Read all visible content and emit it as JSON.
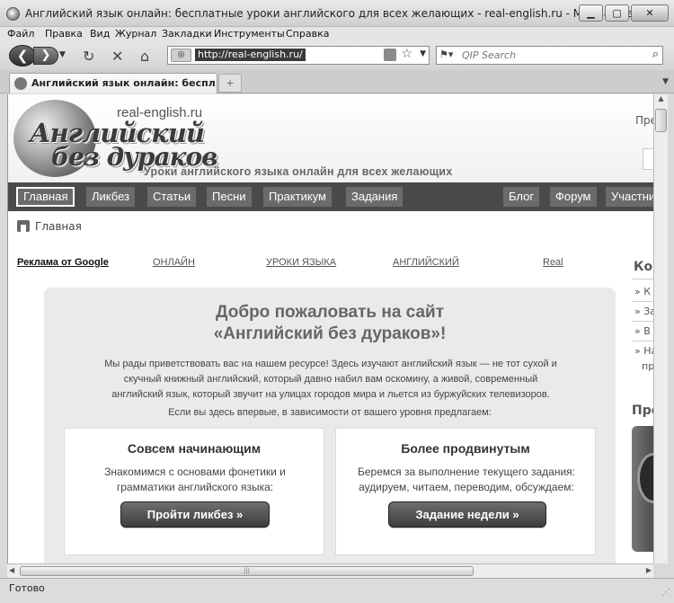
{
  "window": {
    "title": "Английский язык онлайн: бесплатные уроки английского для всех желающих - real-english.ru - Mozilla Firefox",
    "buttons": {
      "minimize": "▁",
      "maximize": "▢",
      "close": "✕"
    }
  },
  "menubar": {
    "items": [
      "Файл",
      "Правка",
      "Вид",
      "Журнал",
      "Закладки",
      "Инструменты",
      "Справка"
    ]
  },
  "toolbar": {
    "url": "http://real-english.ru/",
    "search_placeholder": "QIP Search"
  },
  "tabs": [
    {
      "label": "Английский язык онлайн: бесплат..."
    }
  ],
  "site": {
    "domain": "real-english.ru",
    "logo_line1": "Английский",
    "logo_line2": "без дураков",
    "slogan": "Уроки английского языка онлайн для всех желающих",
    "header_right_text": "Пре"
  },
  "nav": {
    "items": [
      "Главная",
      "Ликбез",
      "Статьи",
      "Песни",
      "Практикум",
      "Задания",
      "Блог",
      "Форум",
      "Участники"
    ],
    "active": "Главная"
  },
  "breadcrumb": {
    "text": "Главная"
  },
  "ads": {
    "label": "Реклама от Google",
    "links": [
      "ОНЛАЙН",
      "УРОКИ ЯЗЫКА",
      "АНГЛИЙСКИЙ",
      "Real"
    ]
  },
  "welcome": {
    "title_line1": "Добро пожаловать на сайт",
    "title_line2": "«Английский без дураков»!",
    "text_line1": "Мы рады приветствовать вас на нашем ресурсе! Здесь изучают английский язык — не тот сухой и",
    "text_line2": "скучный книжный английский, который давно набил вам оскомину, а живой, современный",
    "text_line3": "английский язык, который звучит на улицах городов мира и льется из буржуйских телевизоров.",
    "subtitle": "Если вы здесь впервые, в зависимости от вашего уровня предлагаем:",
    "cards": [
      {
        "title": "Совсем начинающим",
        "text_line1": "Знакомимся с основами фонетики и",
        "text_line2": "грамматики английского языка:",
        "button": "Пройти ликбез »"
      },
      {
        "title": "Более продвинутым",
        "text_line1": "Беремся за выполнение текущего задания:",
        "text_line2": "аудируем, читаем, переводим, обсуждаем:",
        "button": "Задание недели »"
      }
    ]
  },
  "sidebar": {
    "title1": "Кор",
    "items": [
      "» К",
      "» За",
      "» В",
      "» На",
      "пр"
    ],
    "title2": "Пре"
  },
  "status": {
    "text": "Готово"
  }
}
